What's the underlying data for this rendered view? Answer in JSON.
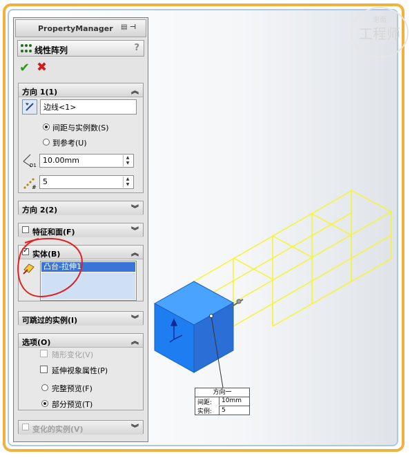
{
  "property_manager": {
    "title": "PropertyManager",
    "feature_name": "线性阵列",
    "help": "?"
  },
  "direction1": {
    "header": "方向 1(1)",
    "edge_value": "边线<1>",
    "opt_spacing": "间距与实例数(S)",
    "opt_reference": "到参考(U)",
    "spacing_value": "10.00mm",
    "count_value": "5",
    "d1_label": "D1",
    "count_label": "#"
  },
  "direction2": {
    "header": "方向 2(2)"
  },
  "features": {
    "header": "特征和面(F)"
  },
  "bodies": {
    "header": "实体(B)",
    "selected": "凸台-拉伸1"
  },
  "skip": {
    "header": "可跳过的实例(I)"
  },
  "options": {
    "header": "选项(O)",
    "vary_sketch": "随形变化(V)",
    "propagate": "延伸视象属性(P)",
    "full_preview": "完整预览(F)",
    "partial_preview": "部分预览(T)"
  },
  "varied": {
    "header": "变化的实例(V)"
  },
  "callout": {
    "title": "方向一",
    "spacing_label": "间距:",
    "spacing_value": "10mm",
    "count_label": "实例:",
    "count_value": "5"
  },
  "watermark": {
    "top": "泡面",
    "main": "工程师"
  },
  "colors": {
    "frame": "#f2b13c",
    "selection": "#3a74d6",
    "preview": "#ffff33",
    "body": "#1e7df0",
    "annotation": "#e02020"
  }
}
